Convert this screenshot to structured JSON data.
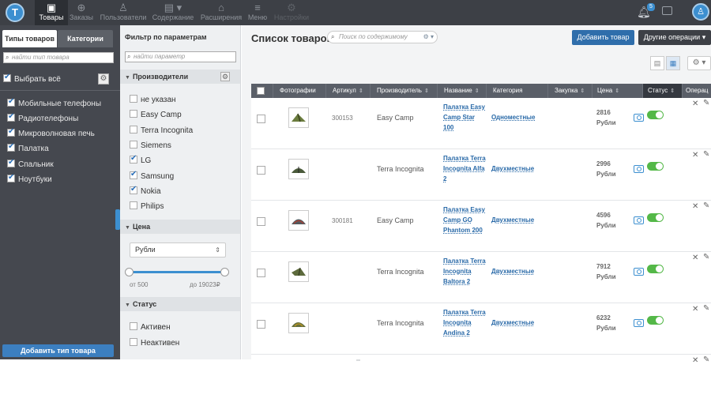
{
  "header": {
    "logo_letter": "T",
    "nav": [
      {
        "label": "Товары",
        "icon": "box-icon",
        "glyph": "▣"
      },
      {
        "label": "Заказы",
        "icon": "cart-icon",
        "glyph": "⊕"
      },
      {
        "label": "Пользователи",
        "icon": "user-icon",
        "glyph": "♙"
      },
      {
        "label": "Содержание",
        "icon": "document-icon",
        "glyph": "▤"
      },
      {
        "label": "Расширения",
        "icon": "puzzle-icon",
        "glyph": "⌂"
      },
      {
        "label": "Меню",
        "icon": "menu-icon",
        "glyph": "≡"
      },
      {
        "label": "Настройки",
        "icon": "settings-icon",
        "glyph": "⚙"
      }
    ],
    "notification_count": "5"
  },
  "left_panel": {
    "tabs": [
      "Типы товаров",
      "Категории"
    ],
    "search_placeholder": "найти тип товара",
    "select_all_label": "Выбрать всё",
    "types": [
      "Мобильные телефоны",
      "Радиотелефоны",
      "Микроволновая печь",
      "Палатка",
      "Спальник",
      "Ноутбуки"
    ],
    "add_button": "Добавить тип товара"
  },
  "filter": {
    "title": "Фильтр по параметрам",
    "search_placeholder": "найти параметр",
    "manufacturers_title": "Производители",
    "manufacturers": [
      {
        "label": "не указан",
        "checked": false
      },
      {
        "label": "Easy Camp",
        "checked": false
      },
      {
        "label": "Terra Incognita",
        "checked": false
      },
      {
        "label": "Siemens",
        "checked": false
      },
      {
        "label": "LG",
        "checked": true
      },
      {
        "label": "Samsung",
        "checked": true
      },
      {
        "label": "Nokia",
        "checked": true
      },
      {
        "label": "Philips",
        "checked": false
      }
    ],
    "price_title": "Цена",
    "currency": "Рубли",
    "price_from": "от 500",
    "price_to": "до 19023₽",
    "status_title": "Статус",
    "statuses": [
      "Активен",
      "Неактивен"
    ]
  },
  "main": {
    "title": "Список товаров",
    "search_placeholder": "Поиск по содержимому",
    "add_button": "Добавить товар",
    "other_button": "Другие операции",
    "columns": [
      "Фотографии",
      "Артикул",
      "Производитель",
      "Название",
      "Категория",
      "Закупка",
      "Цена",
      "Статус",
      "Операц"
    ],
    "rows": [
      {
        "article": "300153",
        "manufacturer": "Easy Camp",
        "name": "Палатка Easy Camp Star 100",
        "category": "Одноместные",
        "price": "2816",
        "currency": "Рубли",
        "active": true
      },
      {
        "article": "",
        "manufacturer": "Terra Incognita",
        "name": "Палатка Terra Incognita Alfa 2",
        "category": "Двухместные",
        "price": "2996",
        "currency": "Рубли",
        "active": true
      },
      {
        "article": "300181",
        "manufacturer": "Easy Camp",
        "name": "Палатка Easy Camp GO Phantom 200",
        "category": "Двухместные",
        "price": "4596",
        "currency": "Рубли",
        "active": true
      },
      {
        "article": "",
        "manufacturer": "Terra Incognita",
        "name": "Палатка Terra Incognita Baltora 2",
        "category": "Двухместные",
        "price": "7912",
        "currency": "Рубли",
        "active": true
      },
      {
        "article": "",
        "manufacturer": "Terra Incognita",
        "name": "Палатка Terra Incognita Andina 2",
        "category": "Двухместные",
        "price": "6232",
        "currency": "Рубли",
        "active": true
      }
    ]
  },
  "colors": {
    "accent": "#3c8fd0",
    "toggle_on": "#54b848",
    "topbar": "#3d4046"
  }
}
